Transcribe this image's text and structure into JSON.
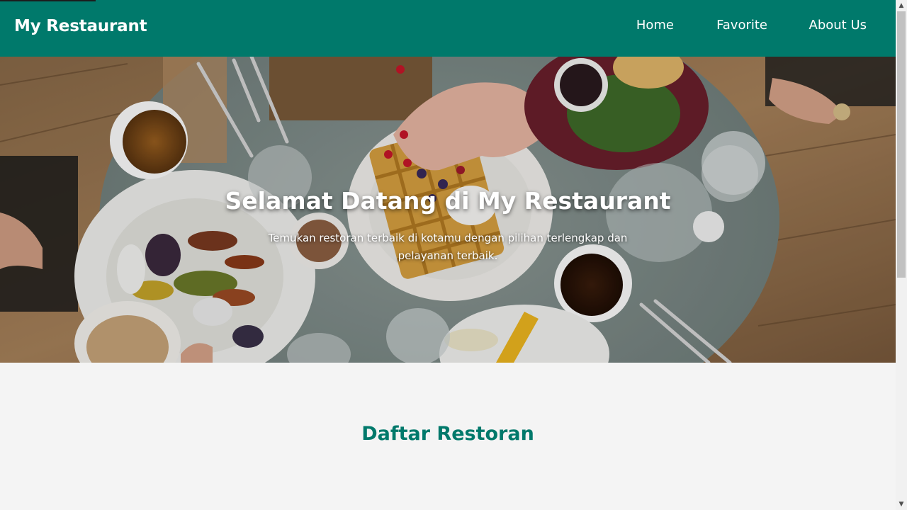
{
  "header": {
    "brand": "My Restaurant",
    "nav": [
      {
        "label": "Home"
      },
      {
        "label": "Favorite"
      },
      {
        "label": "About Us"
      }
    ]
  },
  "hero": {
    "title": "Selamat Datang di My Restaurant",
    "subtitle": "Temukan restoran terbaik di kotamu dengan pilihan terlengkap dan pelayanan terbaik."
  },
  "main": {
    "section_title": "Daftar Restoran"
  },
  "scrollbar": {
    "up_icon": "triangle-up-icon",
    "down_icon": "triangle-down-icon"
  },
  "colors": {
    "primary": "#00796b",
    "page_background": "#f4f4f4"
  }
}
